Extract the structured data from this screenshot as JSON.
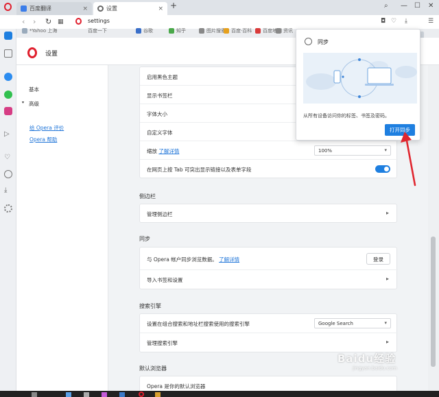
{
  "tabs": [
    {
      "title": "百度翻译"
    },
    {
      "title": "设置"
    }
  ],
  "address": {
    "url": "settings"
  },
  "bookmarks": [
    "*Yahoo 上海",
    "百度一下",
    "谷歌",
    "知乎",
    "图片搜索",
    "百度·百科",
    "百度地图",
    "资讯"
  ],
  "header": {
    "title": "设置"
  },
  "settings_nav": {
    "basic": "基本",
    "advanced": "高级",
    "rate": "给 Opera 评价",
    "help": "Opera 帮助"
  },
  "appearance_rows": {
    "dark_theme": "启用黑色主题",
    "bookmarks_bar": "显示书签栏",
    "font_size": "字体大小",
    "custom_fonts": "自定义字体",
    "zoom": "缩放",
    "zoom_link": "了解详情",
    "zoom_value": "100%",
    "tab_highlight": "在网页上按 Tab 可突出显示链接以及表单字段"
  },
  "sidebar_section": {
    "title": "侧边栏",
    "manage": "管理侧边栏"
  },
  "sync_section": {
    "title": "同步",
    "account_text": "与 Opera 帐户同步浏览数据。",
    "learn_more": "了解详情",
    "login_button": "登录",
    "import": "导入书签和设置"
  },
  "search_section": {
    "title": "搜索引擎",
    "default_label": "设置在组合搜索和地址栏搜索使用的搜索引擎",
    "engine": "Google Search",
    "manage": "管理搜索引擎"
  },
  "default_browser_section": {
    "title": "默认浏览器",
    "row": "Opera 是你的默认浏览器"
  },
  "sync_popup": {
    "title": "同步",
    "description": "从所有设备访问你的标签、书签及密码。",
    "button": "打开同步"
  },
  "watermark": {
    "text": "Baidu经验",
    "sub": "jingyan.baidu.com"
  },
  "colors": {
    "accent": "#1e7fe0",
    "opera_red": "#e01f2d",
    "annotation_arrow": "#e0262f"
  }
}
